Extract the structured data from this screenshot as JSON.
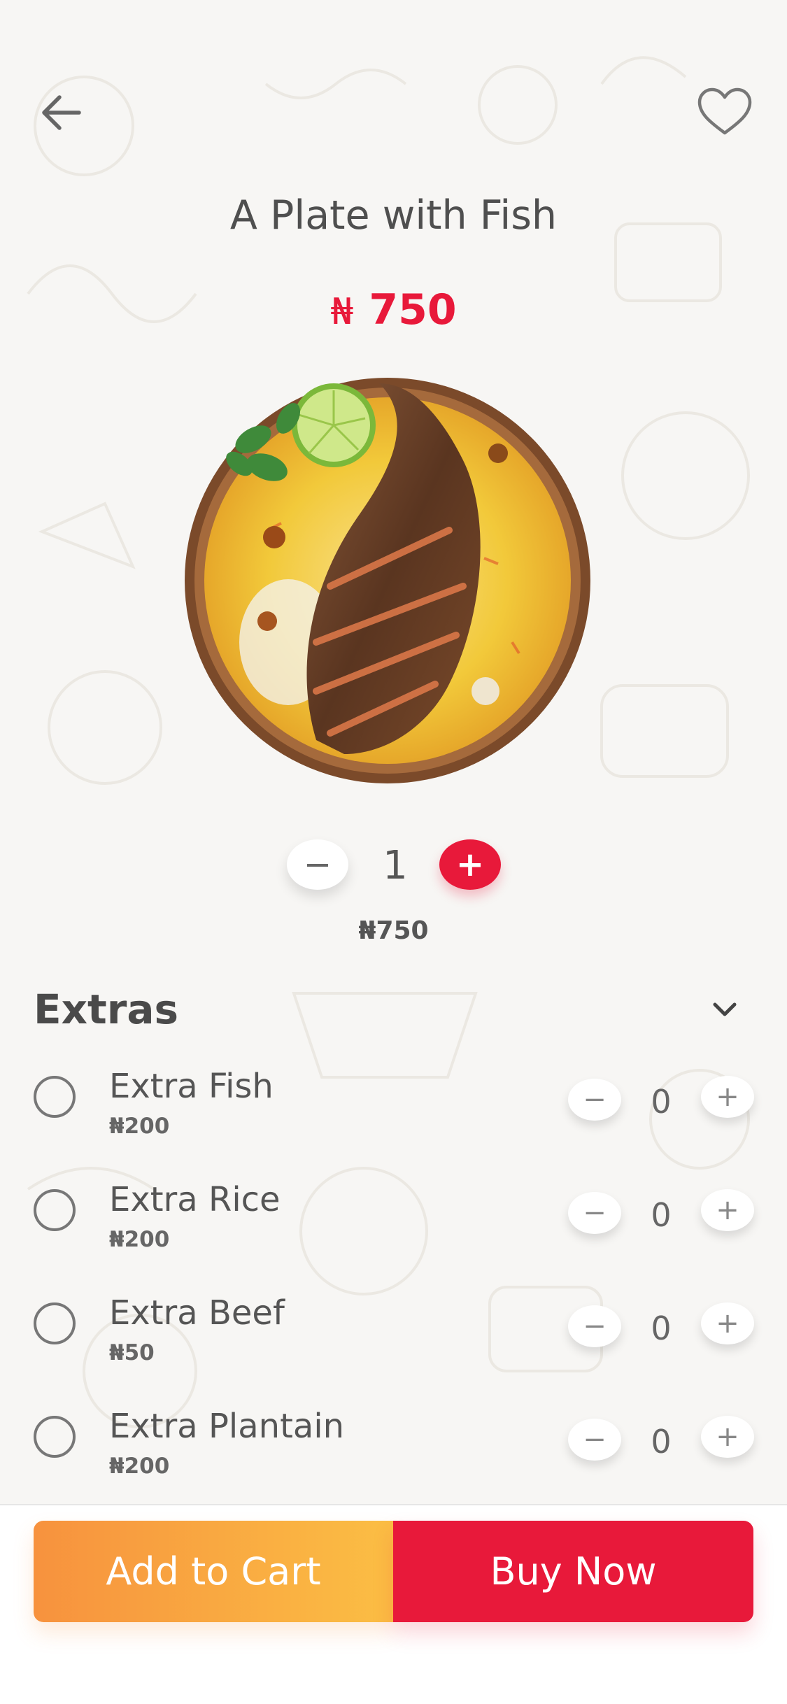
{
  "header": {
    "back_icon": "arrow-left-icon",
    "favorite_icon": "heart-outline-icon"
  },
  "product": {
    "title": "A Plate with  Fish",
    "currency_symbol": "₦",
    "price": "750",
    "image": "fish-and-rice-plate"
  },
  "quantity": {
    "minus": "−",
    "value": "1",
    "plus": "+",
    "subtotal": "₦750"
  },
  "extras": {
    "title": "Extras",
    "chevron_icon": "chevron-down-icon",
    "items": [
      {
        "name": "Extra Fish",
        "price": "₦200",
        "qty": "0",
        "minus": "−",
        "plus": "+"
      },
      {
        "name": "Extra Rice",
        "price": "₦200",
        "qty": "0",
        "minus": "−",
        "plus": "+"
      },
      {
        "name": "Extra Beef",
        "price": "₦50",
        "qty": "0",
        "minus": "−",
        "plus": "+"
      },
      {
        "name": "Extra Plantain",
        "price": "₦200",
        "qty": "0",
        "minus": "−",
        "plus": "+"
      }
    ]
  },
  "actions": {
    "add_to_cart": "Add to Cart",
    "buy_now": "Buy Now"
  },
  "colors": {
    "accent_red": "#e8193a",
    "accent_orange_start": "#f7923e",
    "accent_orange_end": "#fbbe44",
    "background": "#f7f6f4"
  }
}
